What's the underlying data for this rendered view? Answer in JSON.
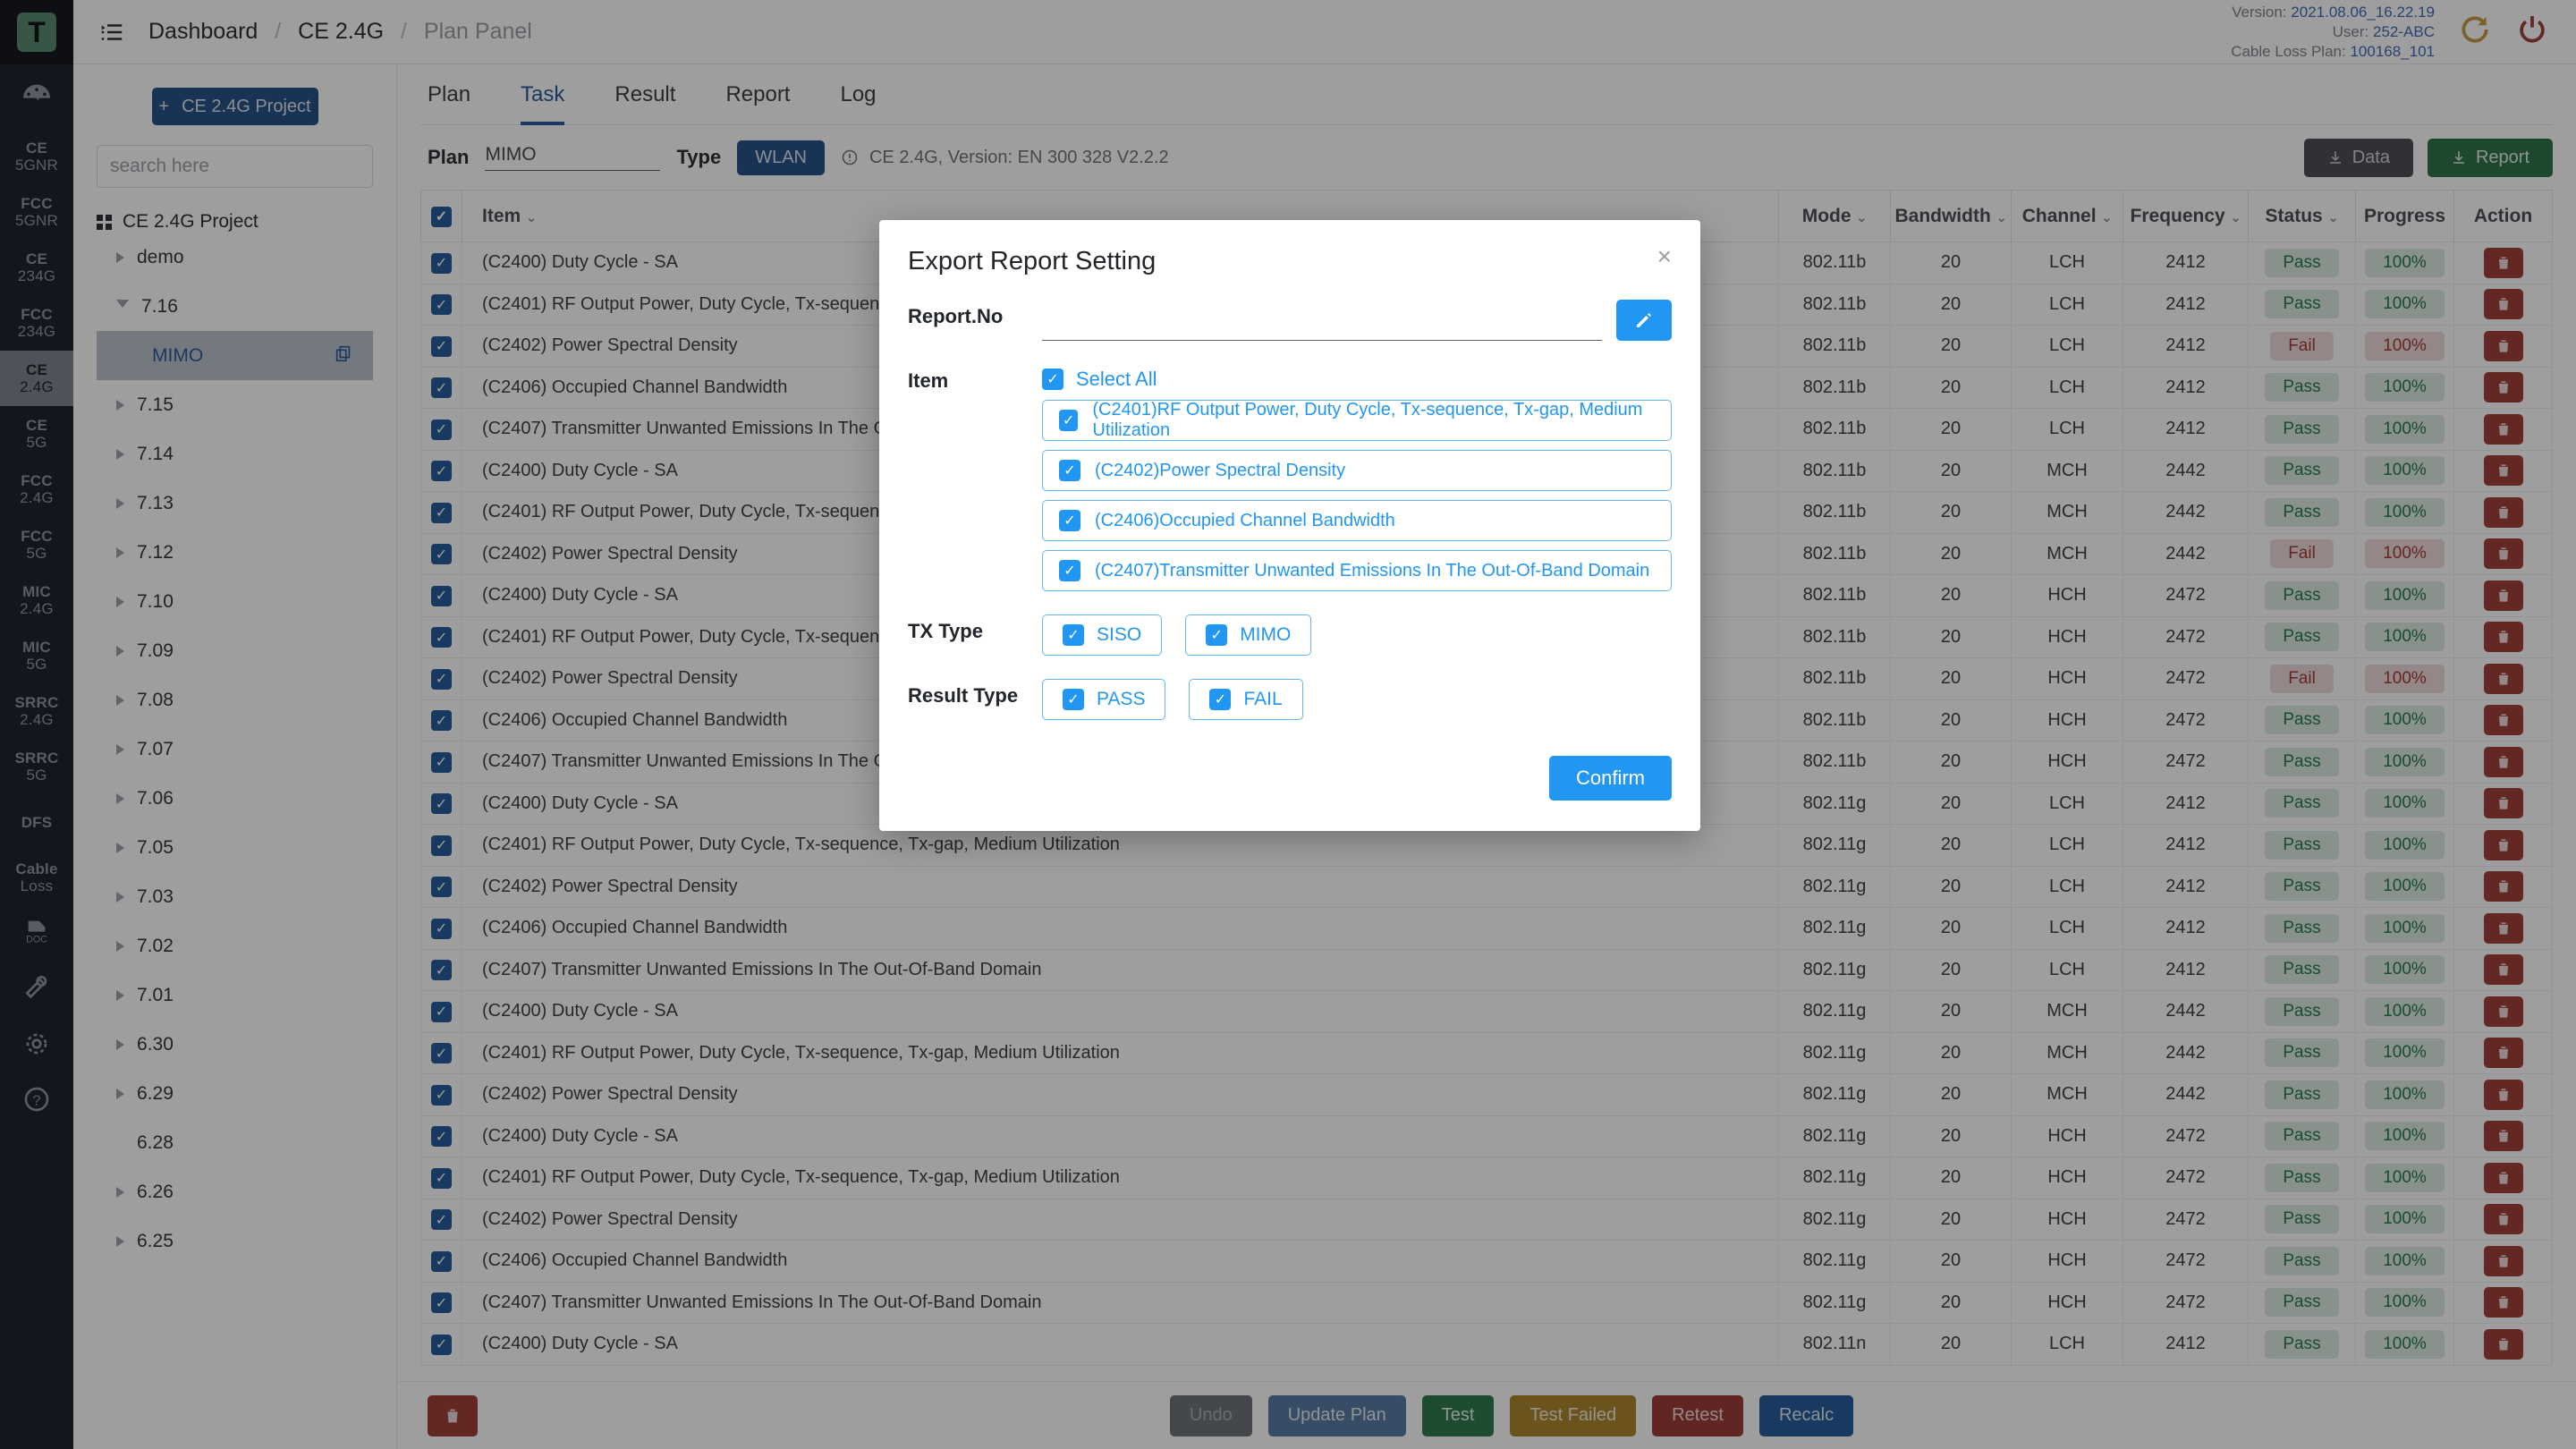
{
  "header": {
    "breadcrumb": [
      "Dashboard",
      "CE 2.4G",
      "Plan Panel"
    ],
    "version_label": "Version:",
    "version_value": "2021.08.06_16.22.19",
    "user_label": "User:",
    "user_value": "252-ABC",
    "cable_label": "Cable Loss Plan:",
    "cable_value": "100168_101"
  },
  "rail": {
    "logo": "T",
    "items": [
      {
        "l1": "CE",
        "l2": "5GNR",
        "active": false
      },
      {
        "l1": "FCC",
        "l2": "5GNR",
        "active": false
      },
      {
        "l1": "CE",
        "l2": "234G",
        "active": false
      },
      {
        "l1": "FCC",
        "l2": "234G",
        "active": false
      },
      {
        "l1": "CE",
        "l2": "2.4G",
        "active": true
      },
      {
        "l1": "CE",
        "l2": "5G",
        "active": false
      },
      {
        "l1": "FCC",
        "l2": "2.4G",
        "active": false
      },
      {
        "l1": "FCC",
        "l2": "5G",
        "active": false
      },
      {
        "l1": "MIC",
        "l2": "2.4G",
        "active": false
      },
      {
        "l1": "MIC",
        "l2": "5G",
        "active": false
      },
      {
        "l1": "SRRC",
        "l2": "2.4G",
        "active": false
      },
      {
        "l1": "SRRC",
        "l2": "5G",
        "active": false
      },
      {
        "l1": "DFS",
        "l2": "",
        "active": false
      },
      {
        "l1": "Cable",
        "l2": "Loss",
        "active": false
      }
    ],
    "bottom_icons": [
      "doc-icon",
      "wrench-icon",
      "gear-icon",
      "help-icon"
    ]
  },
  "sidebar": {
    "new_project_label": "CE 2.4G Project",
    "search_placeholder": "search here",
    "root_label": "CE 2.4G Project",
    "nodes": [
      {
        "label": "demo",
        "state": "collapsed",
        "child": false
      },
      {
        "label": "7.16",
        "state": "expanded",
        "child": false
      },
      {
        "label": "MIMO",
        "state": "leaf",
        "child": true,
        "selected": true
      },
      {
        "label": "7.15",
        "state": "collapsed",
        "child": false
      },
      {
        "label": "7.14",
        "state": "collapsed",
        "child": false
      },
      {
        "label": "7.13",
        "state": "collapsed",
        "child": false
      },
      {
        "label": "7.12",
        "state": "collapsed",
        "child": false
      },
      {
        "label": "7.10",
        "state": "collapsed",
        "child": false
      },
      {
        "label": "7.09",
        "state": "collapsed",
        "child": false
      },
      {
        "label": "7.08",
        "state": "collapsed",
        "child": false
      },
      {
        "label": "7.07",
        "state": "collapsed",
        "child": false
      },
      {
        "label": "7.06",
        "state": "collapsed",
        "child": false
      },
      {
        "label": "7.05",
        "state": "collapsed",
        "child": false
      },
      {
        "label": "7.03",
        "state": "collapsed",
        "child": false
      },
      {
        "label": "7.02",
        "state": "collapsed",
        "child": false
      },
      {
        "label": "7.01",
        "state": "collapsed",
        "child": false
      },
      {
        "label": "6.30",
        "state": "collapsed",
        "child": false
      },
      {
        "label": "6.29",
        "state": "collapsed",
        "child": false
      },
      {
        "label": "6.28",
        "state": "none",
        "child": false
      },
      {
        "label": "6.26",
        "state": "collapsed",
        "child": false
      },
      {
        "label": "6.25",
        "state": "collapsed",
        "child": false
      }
    ]
  },
  "main": {
    "tabs": [
      {
        "label": "Plan",
        "active": false
      },
      {
        "label": "Task",
        "active": true
      },
      {
        "label": "Result",
        "active": false
      },
      {
        "label": "Report",
        "active": false
      },
      {
        "label": "Log",
        "active": false
      }
    ],
    "plan_label": "Plan",
    "plan_value": "MIMO",
    "type_label": "Type",
    "type_value": "WLAN",
    "version_note": "CE 2.4G, Version: EN 300 328 V2.2.2",
    "data_button": "Data",
    "report_button": "Report",
    "columns": [
      "Item",
      "Mode",
      "Bandwidth",
      "Channel",
      "Frequency",
      "Status",
      "Progress",
      "Action"
    ],
    "rows": [
      {
        "item": "(C2400) Duty Cycle - SA",
        "mode": "802.11b",
        "bw": "20",
        "ch": "LCH",
        "freq": "2412",
        "status": "Pass",
        "progress": "100%"
      },
      {
        "item": "(C2401) RF Output Power, Duty Cycle, Tx-sequence, Tx-gap, Medium Utilization",
        "mode": "802.11b",
        "bw": "20",
        "ch": "LCH",
        "freq": "2412",
        "status": "Pass",
        "progress": "100%"
      },
      {
        "item": "(C2402) Power Spectral Density",
        "mode": "802.11b",
        "bw": "20",
        "ch": "LCH",
        "freq": "2412",
        "status": "Fail",
        "progress": "100%"
      },
      {
        "item": "(C2406) Occupied Channel Bandwidth",
        "mode": "802.11b",
        "bw": "20",
        "ch": "LCH",
        "freq": "2412",
        "status": "Pass",
        "progress": "100%"
      },
      {
        "item": "(C2407) Transmitter Unwanted Emissions In The Out-Of-Band Domain",
        "mode": "802.11b",
        "bw": "20",
        "ch": "LCH",
        "freq": "2412",
        "status": "Pass",
        "progress": "100%"
      },
      {
        "item": "(C2400) Duty Cycle - SA",
        "mode": "802.11b",
        "bw": "20",
        "ch": "MCH",
        "freq": "2442",
        "status": "Pass",
        "progress": "100%"
      },
      {
        "item": "(C2401) RF Output Power, Duty Cycle, Tx-sequence, Tx-gap, Medium Utilization",
        "mode": "802.11b",
        "bw": "20",
        "ch": "MCH",
        "freq": "2442",
        "status": "Pass",
        "progress": "100%"
      },
      {
        "item": "(C2402) Power Spectral Density",
        "mode": "802.11b",
        "bw": "20",
        "ch": "MCH",
        "freq": "2442",
        "status": "Fail",
        "progress": "100%"
      },
      {
        "item": "(C2400) Duty Cycle - SA",
        "mode": "802.11b",
        "bw": "20",
        "ch": "HCH",
        "freq": "2472",
        "status": "Pass",
        "progress": "100%"
      },
      {
        "item": "(C2401) RF Output Power, Duty Cycle, Tx-sequence, Tx-gap, Medium Utilization",
        "mode": "802.11b",
        "bw": "20",
        "ch": "HCH",
        "freq": "2472",
        "status": "Pass",
        "progress": "100%"
      },
      {
        "item": "(C2402) Power Spectral Density",
        "mode": "802.11b",
        "bw": "20",
        "ch": "HCH",
        "freq": "2472",
        "status": "Fail",
        "progress": "100%"
      },
      {
        "item": "(C2406) Occupied Channel Bandwidth",
        "mode": "802.11b",
        "bw": "20",
        "ch": "HCH",
        "freq": "2472",
        "status": "Pass",
        "progress": "100%"
      },
      {
        "item": "(C2407) Transmitter Unwanted Emissions In The Out-Of-Band Domain",
        "mode": "802.11b",
        "bw": "20",
        "ch": "HCH",
        "freq": "2472",
        "status": "Pass",
        "progress": "100%"
      },
      {
        "item": "(C2400) Duty Cycle - SA",
        "mode": "802.11g",
        "bw": "20",
        "ch": "LCH",
        "freq": "2412",
        "status": "Pass",
        "progress": "100%"
      },
      {
        "item": "(C2401) RF Output Power, Duty Cycle, Tx-sequence, Tx-gap, Medium Utilization",
        "mode": "802.11g",
        "bw": "20",
        "ch": "LCH",
        "freq": "2412",
        "status": "Pass",
        "progress": "100%"
      },
      {
        "item": "(C2402) Power Spectral Density",
        "mode": "802.11g",
        "bw": "20",
        "ch": "LCH",
        "freq": "2412",
        "status": "Pass",
        "progress": "100%"
      },
      {
        "item": "(C2406) Occupied Channel Bandwidth",
        "mode": "802.11g",
        "bw": "20",
        "ch": "LCH",
        "freq": "2412",
        "status": "Pass",
        "progress": "100%"
      },
      {
        "item": "(C2407) Transmitter Unwanted Emissions In The Out-Of-Band Domain",
        "mode": "802.11g",
        "bw": "20",
        "ch": "LCH",
        "freq": "2412",
        "status": "Pass",
        "progress": "100%"
      },
      {
        "item": "(C2400) Duty Cycle - SA",
        "mode": "802.11g",
        "bw": "20",
        "ch": "MCH",
        "freq": "2442",
        "status": "Pass",
        "progress": "100%"
      },
      {
        "item": "(C2401) RF Output Power, Duty Cycle, Tx-sequence, Tx-gap, Medium Utilization",
        "mode": "802.11g",
        "bw": "20",
        "ch": "MCH",
        "freq": "2442",
        "status": "Pass",
        "progress": "100%"
      },
      {
        "item": "(C2402) Power Spectral Density",
        "mode": "802.11g",
        "bw": "20",
        "ch": "MCH",
        "freq": "2442",
        "status": "Pass",
        "progress": "100%"
      },
      {
        "item": "(C2400) Duty Cycle - SA",
        "mode": "802.11g",
        "bw": "20",
        "ch": "HCH",
        "freq": "2472",
        "status": "Pass",
        "progress": "100%"
      },
      {
        "item": "(C2401) RF Output Power, Duty Cycle, Tx-sequence, Tx-gap, Medium Utilization",
        "mode": "802.11g",
        "bw": "20",
        "ch": "HCH",
        "freq": "2472",
        "status": "Pass",
        "progress": "100%"
      },
      {
        "item": "(C2402) Power Spectral Density",
        "mode": "802.11g",
        "bw": "20",
        "ch": "HCH",
        "freq": "2472",
        "status": "Pass",
        "progress": "100%"
      },
      {
        "item": "(C2406) Occupied Channel Bandwidth",
        "mode": "802.11g",
        "bw": "20",
        "ch": "HCH",
        "freq": "2472",
        "status": "Pass",
        "progress": "100%"
      },
      {
        "item": "(C2407) Transmitter Unwanted Emissions In The Out-Of-Band Domain",
        "mode": "802.11g",
        "bw": "20",
        "ch": "HCH",
        "freq": "2472",
        "status": "Pass",
        "progress": "100%"
      },
      {
        "item": "(C2400) Duty Cycle - SA",
        "mode": "802.11n",
        "bw": "20",
        "ch": "LCH",
        "freq": "2412",
        "status": "Pass",
        "progress": "100%"
      }
    ]
  },
  "footer": {
    "buttons": [
      {
        "label": "Undo",
        "cls": "f-undo"
      },
      {
        "label": "Update Plan",
        "cls": "f-update"
      },
      {
        "label": "Test",
        "cls": "f-test"
      },
      {
        "label": "Test Failed",
        "cls": "f-failed"
      },
      {
        "label": "Retest",
        "cls": "f-retest"
      },
      {
        "label": "Recalc",
        "cls": "f-recalc"
      }
    ]
  },
  "modal": {
    "title": "Export Report Setting",
    "report_no_label": "Report.No",
    "report_no_value": "",
    "item_label": "Item",
    "select_all_label": "Select All",
    "items": [
      "(C2401)RF Output Power, Duty Cycle, Tx-sequence, Tx-gap, Medium Utilization",
      "(C2402)Power Spectral Density",
      "(C2406)Occupied Channel Bandwidth",
      "(C2407)Transmitter Unwanted Emissions In The Out-Of-Band Domain"
    ],
    "tx_type_label": "TX Type",
    "tx_types": [
      "SISO",
      "MIMO"
    ],
    "result_type_label": "Result Type",
    "result_types": [
      "PASS",
      "FAIL"
    ],
    "confirm_label": "Confirm"
  },
  "colors": {
    "accent": "#2196f3",
    "pass": "#12833f",
    "fail": "#c0362f",
    "brand_dark": "#1c2433"
  }
}
